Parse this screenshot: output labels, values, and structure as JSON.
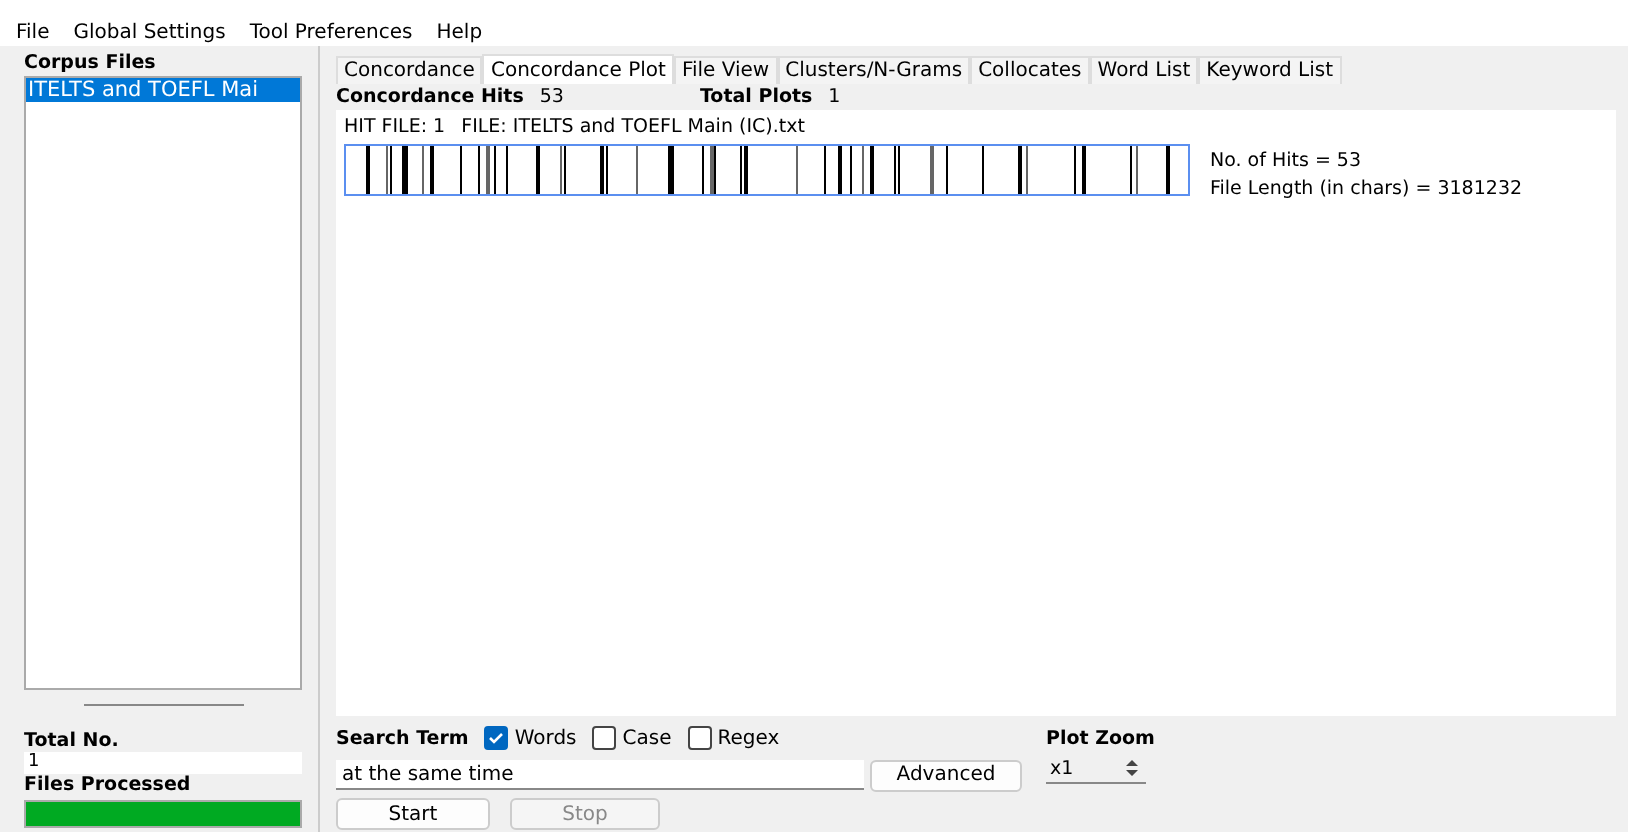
{
  "menu": [
    "File",
    "Global Settings",
    "Tool Preferences",
    "Help"
  ],
  "sidebar": {
    "title": "Corpus Files",
    "files": [
      {
        "name": "ITELTS and TOEFL Mai",
        "selected": true
      }
    ],
    "total_label": "Total No.",
    "total_value": "1",
    "processed_label": "Files Processed",
    "progress": {
      "level": 1
    }
  },
  "tabs": [
    {
      "label": "Concordance",
      "selected": false
    },
    {
      "label": "Concordance Plot",
      "selected": true
    },
    {
      "label": "File View",
      "selected": false
    },
    {
      "label": "Clusters/N-Grams",
      "selected": false
    },
    {
      "label": "Collocates",
      "selected": false
    },
    {
      "label": "Word List",
      "selected": false
    },
    {
      "label": "Keyword List",
      "selected": false
    }
  ],
  "summary": {
    "hits_label": "Concordance Hits",
    "hits_value": "53",
    "plots_label": "Total Plots",
    "plots_value": "1"
  },
  "plot": {
    "hit_file": "HIT FILE: 1",
    "file": "FILE: ITELTS and TOEFL Main (IC).txt",
    "hits": "No. of Hits = 53",
    "length": "File Length (in chars) = 3181232"
  },
  "search": {
    "label": "Search Term",
    "options": [
      {
        "label": "Words",
        "checked": true
      },
      {
        "label": "Case",
        "checked": false
      },
      {
        "label": "Regex",
        "checked": false
      }
    ],
    "value": "at the same time",
    "advanced": "Advanced",
    "start": "Start",
    "stop": "Stop"
  },
  "zoom": {
    "label": "Plot Zoom",
    "value": "x1"
  }
}
